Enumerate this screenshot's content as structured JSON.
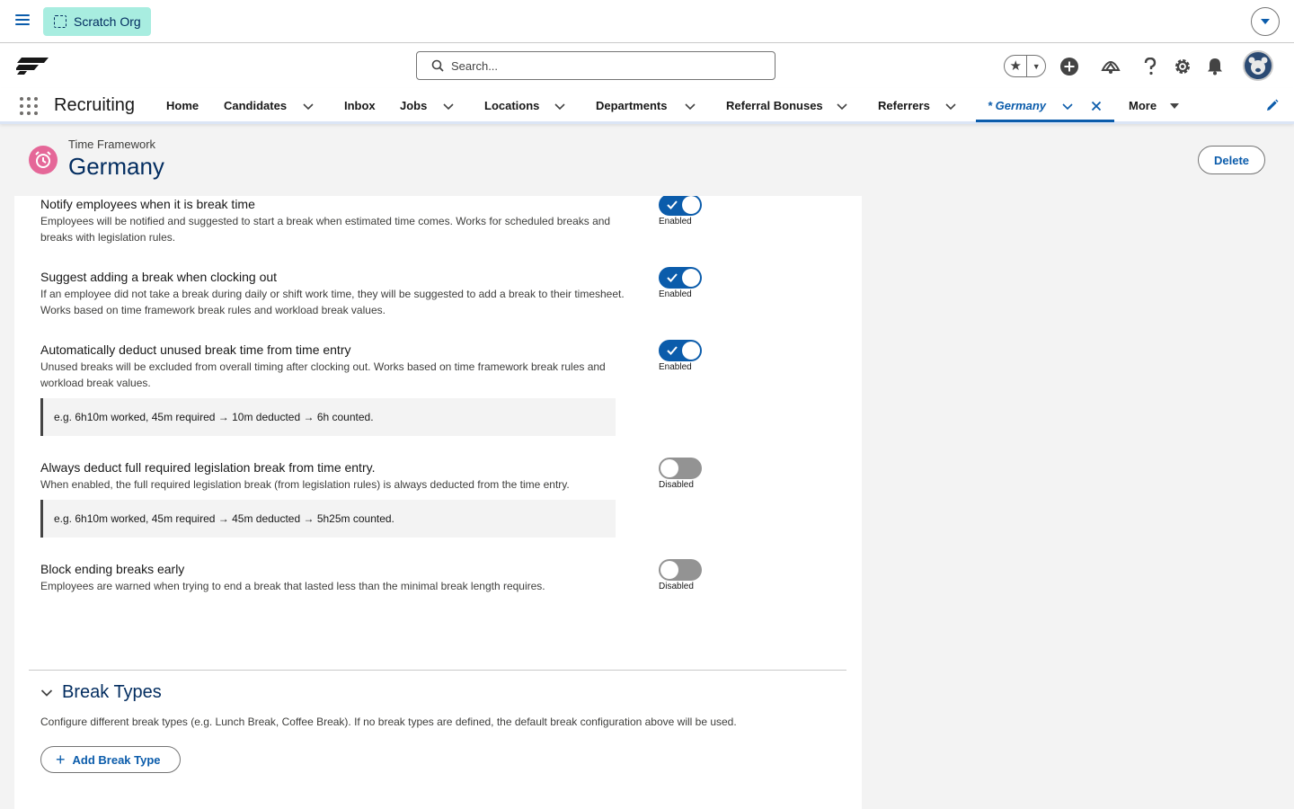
{
  "topbar": {
    "org_label": "Scratch Org"
  },
  "header": {
    "search_placeholder": "Search...",
    "icons": [
      "favorites-star-icon",
      "add-icon",
      "trailhead-icon",
      "help-icon",
      "setup-gear-icon",
      "notifications-bell-icon",
      "user-avatar"
    ]
  },
  "nav": {
    "app_name": "Recruiting",
    "items": [
      {
        "label": "Home",
        "has_menu": false
      },
      {
        "label": "Candidates",
        "has_menu": true
      },
      {
        "label": "Inbox",
        "has_menu": false
      },
      {
        "label": "Jobs",
        "has_menu": true
      },
      {
        "label": "Locations",
        "has_menu": true
      },
      {
        "label": "Departments",
        "has_menu": true
      },
      {
        "label": "Referral Bonuses",
        "has_menu": true
      },
      {
        "label": "Referrers",
        "has_menu": true
      },
      {
        "label": "* Germany",
        "has_menu": true,
        "active": true,
        "closable": true
      },
      {
        "label": "More",
        "has_menu": true
      }
    ]
  },
  "page": {
    "object_type": "Time Framework",
    "title": "Germany",
    "delete_label": "Delete"
  },
  "settings": [
    {
      "title": "Notify employees when it is break time",
      "description": "Employees will be notified and suggested to start a break when estimated time comes. Works for scheduled breaks and breaks with legislation rules.",
      "enabled": true,
      "state_label": "Enabled"
    },
    {
      "title": "Suggest adding a break when clocking out",
      "description": "If an employee did not take a break during daily or shift work time, they will be suggested to add a break to their timesheet. Works based on time framework break rules and workload break values.",
      "enabled": true,
      "state_label": "Enabled"
    },
    {
      "title": "Automatically deduct unused break time from time entry",
      "description": "Unused breaks will be excluded from overall timing after clocking out. Works based on time framework break rules and workload break values.",
      "example": "e.g. 6h10m worked, 45m required → 10m deducted → 6h counted.",
      "enabled": true,
      "state_label": "Enabled"
    },
    {
      "title": "Always deduct full required legislation break from time entry.",
      "description": "When enabled, the full required legislation break (from legislation rules) is always deducted from the time entry.",
      "example": "e.g. 6h10m worked, 45m required → 45m deducted → 5h25m counted.",
      "enabled": false,
      "state_label": "Disabled"
    },
    {
      "title": "Block ending breaks early",
      "description": "Employees are warned when trying to end a break that lasted less than the minimal break length requires.",
      "enabled": false,
      "state_label": "Disabled"
    }
  ],
  "break_types": {
    "title": "Break Types",
    "description": "Configure different break types (e.g. Lunch Break, Coffee Break). If no break types are defined, the default break configuration above will be used.",
    "add_label": "Add Break Type"
  },
  "colors": {
    "brand": "#0b5cab",
    "title_navy": "#032d60",
    "org_badge": "#a8ede0",
    "record_icon": "#e56798"
  }
}
